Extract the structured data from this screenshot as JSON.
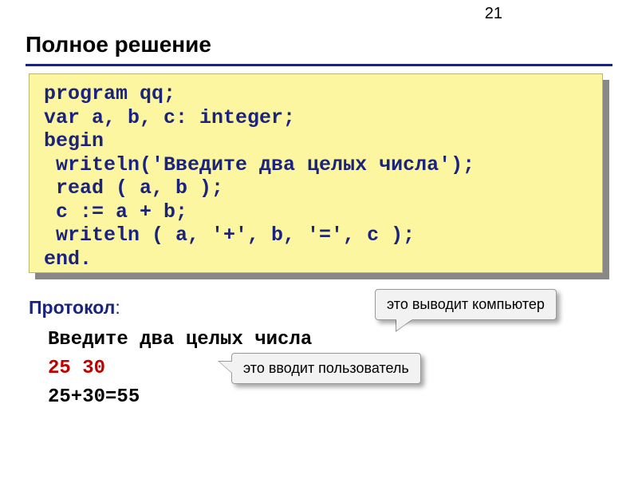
{
  "page_number": "21",
  "title": "Полное решение",
  "code": {
    "lines": [
      "program qq;",
      "var a, b, c: integer;",
      "begin",
      " writeln('Введите два целых числа');",
      " read ( a, b );",
      " c := a + b;",
      " writeln ( a, '+', b, '=', c );",
      "end."
    ]
  },
  "protocol": {
    "label_bold": "Протокол",
    "label_suffix": ":",
    "line_prompt": "Введите два целых числа",
    "line_input": "25 30",
    "line_output": "25+30=55"
  },
  "callouts": {
    "computer_output": "это выводит компьютер",
    "user_input": "это вводит пользователь"
  }
}
